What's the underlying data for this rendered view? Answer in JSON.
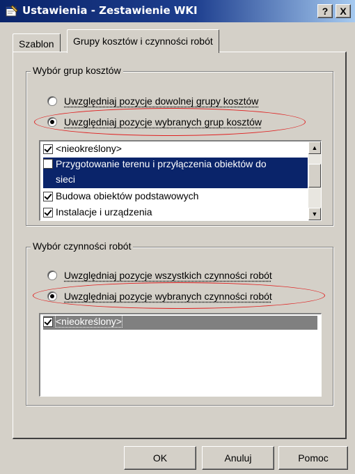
{
  "window": {
    "title": "Ustawienia - Zestawienie WKI",
    "help_label": "?",
    "close_label": "X"
  },
  "tabs": [
    {
      "label": "Szablon",
      "active": false
    },
    {
      "label": "Grupy kosztów i czynności robót",
      "active": true
    }
  ],
  "cost_groups": {
    "legend": "Wybór grup kosztów",
    "radio_any": "Uwzględniaj pozycje dowolnej grupy kosztów",
    "radio_selected": "Uwzględniaj pozycje wybranych grup kosztów",
    "selected_option": "radio_selected",
    "items": [
      {
        "label": "<nieokreślony>",
        "checked": true,
        "state": "normal"
      },
      {
        "label_line1": "Przygotowanie terenu i przyłączenia obiektów do",
        "label_line2": "sieci",
        "checked": false,
        "state": "selected"
      },
      {
        "label": "Budowa obiektów podstawowych",
        "checked": true,
        "state": "normal"
      },
      {
        "label": "Instalacje i urządzenia",
        "checked": true,
        "state": "normal"
      }
    ]
  },
  "work_activities": {
    "legend": "Wybór czynności robót",
    "radio_all": "Uwzględniaj pozycje wszystkich czynności robót",
    "radio_selected": "Uwzględniaj pozycje wybranych czynności robót",
    "selected_option": "radio_selected",
    "items": [
      {
        "label": "<nieokreślony>",
        "checked": true,
        "state": "selected-inactive"
      }
    ]
  },
  "buttons": {
    "ok": "OK",
    "cancel": "Anuluj",
    "help": "Pomoc"
  },
  "colors": {
    "selection": "#0a246a",
    "selection_inactive": "#808080",
    "highlight_ellipse": "#e02020"
  },
  "icons": {
    "title": "properties-icon",
    "scroll_up": "scroll-up-arrow-icon",
    "scroll_down": "scroll-down-arrow-icon"
  }
}
